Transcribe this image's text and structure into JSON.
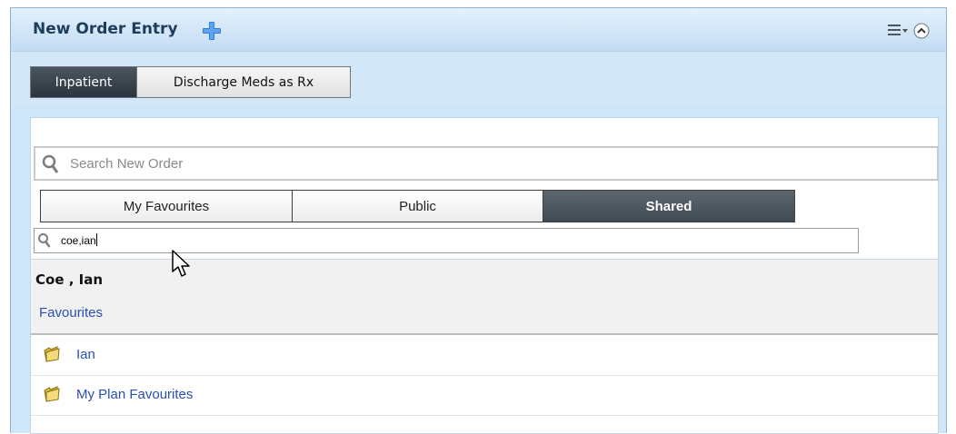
{
  "panel": {
    "title": "New Order Entry"
  },
  "tabs": [
    {
      "label": "Inpatient",
      "active": true
    },
    {
      "label": "Discharge Meds as Rx",
      "active": false
    }
  ],
  "search": {
    "placeholder": "Search New Order"
  },
  "sub_tabs": [
    {
      "label": "My Favourites",
      "active": false
    },
    {
      "label": "Public",
      "active": false
    },
    {
      "label": "Shared",
      "active": true
    }
  ],
  "user_search": {
    "value": "coe,ian"
  },
  "owner": {
    "name": "Coe , Ian",
    "link": "Favourites"
  },
  "folders": [
    {
      "label": "Ian",
      "icon": "folder-icon"
    },
    {
      "label": "My Plan Favourites",
      "icon": "folder-icon"
    }
  ],
  "colors": {
    "header_bg": "#c3dcf3",
    "active_tab": "#2c353e",
    "link": "#2a4fb3",
    "plus_icon": "#2f7fd6"
  }
}
